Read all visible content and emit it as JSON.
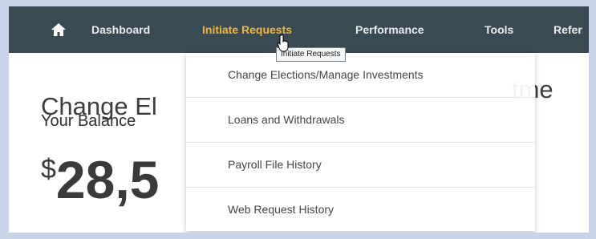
{
  "nav": {
    "items": [
      {
        "label": "Dashboard"
      },
      {
        "label": "Initiate Requests"
      },
      {
        "label": "Performance"
      },
      {
        "label": "Tools"
      },
      {
        "label": "Refer"
      }
    ],
    "tooltip": "Initiate Requests"
  },
  "main": {
    "title_left": "Change El",
    "title_right": "tme",
    "balance_label": "Your Balance",
    "amount_symbol": "$",
    "amount_visible": "28,5"
  },
  "dropdown": {
    "items": [
      {
        "label": "Change Elections/Manage Investments"
      },
      {
        "label": "Loans and Withdrawals"
      },
      {
        "label": "Payroll File History"
      },
      {
        "label": "Web Request History"
      }
    ]
  },
  "colors": {
    "nav_bg": "#3a4a53",
    "active": "#f3b43a",
    "outer_bg": "#c9d3ea"
  }
}
